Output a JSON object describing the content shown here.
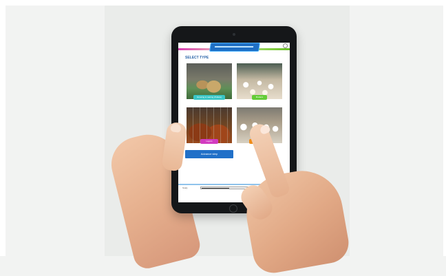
{
  "scene": {
    "background_color": "#f2f3f2",
    "tablet_color": "#151719"
  },
  "app": {
    "logo_icon": "app-logo",
    "section_title": "SELECT TYPE",
    "tiles": [
      {
        "caption": "Growing & rearing (Pullets)",
        "color": "#39c6c6",
        "image": "chicks-photo"
      },
      {
        "caption": "Broilers",
        "color": "#64cc38",
        "image": "broiler-house-photo"
      },
      {
        "caption": "Layers",
        "color": "#d23bc0",
        "image": "layer-cages-photo"
      },
      {
        "caption": "Breeders",
        "color": "#f08c18",
        "image": "breeder-house-photo"
      }
    ],
    "advance_button": "Advance step",
    "footer_label": "Study",
    "progress": 0.35,
    "accent_color": "#2170c8"
  }
}
